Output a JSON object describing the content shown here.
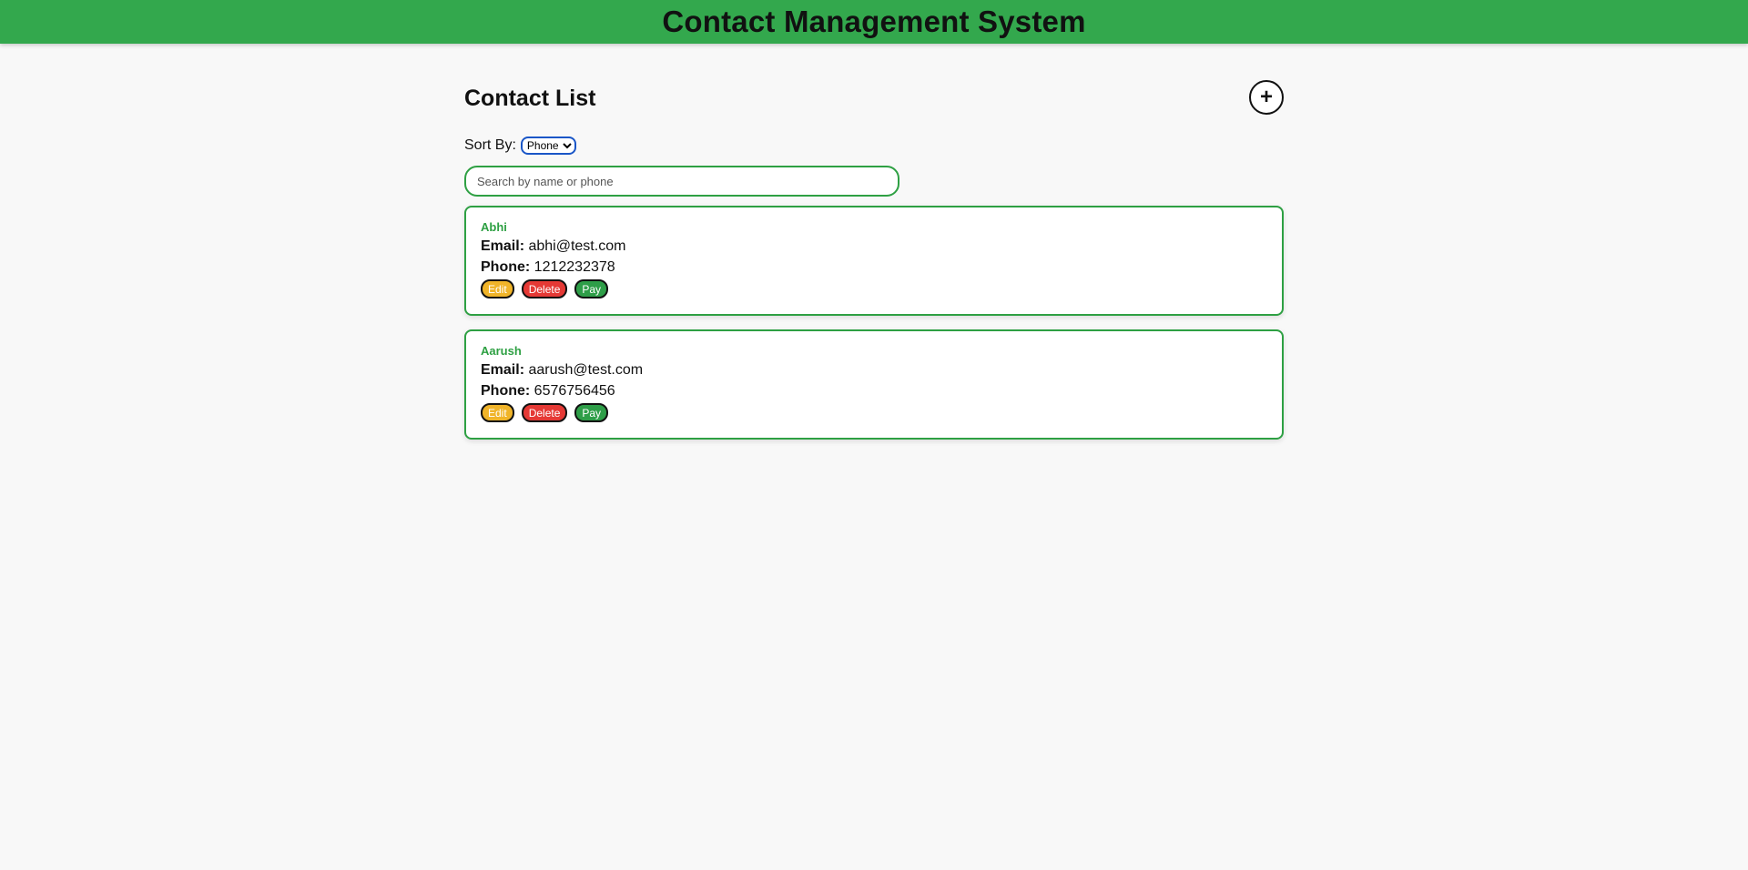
{
  "header": {
    "title": "Contact Management System"
  },
  "page": {
    "title": "Contact List",
    "add_label": "+"
  },
  "sort": {
    "label": "Sort By:",
    "selected": "Phone"
  },
  "search": {
    "placeholder": "Search by name or phone"
  },
  "field_labels": {
    "email": "Email:",
    "phone": "Phone:"
  },
  "buttons": {
    "edit": "Edit",
    "delete": "Delete",
    "pay": "Pay"
  },
  "contacts": [
    {
      "name": "Abhi",
      "email": "abhi@test.com",
      "phone": "1212232378"
    },
    {
      "name": "Aarush",
      "email": "aarush@test.com",
      "phone": "6576756456"
    }
  ],
  "colors": {
    "header_bg": "#33a84d",
    "accent": "#2ea043",
    "edit": "#f0b429",
    "delete": "#e53935",
    "pay": "#2e9e48"
  }
}
